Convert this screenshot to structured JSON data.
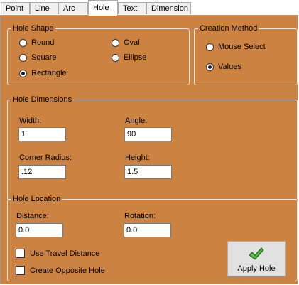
{
  "tabs": [
    {
      "label": "Point"
    },
    {
      "label": "Line"
    },
    {
      "label": "Arc"
    },
    {
      "label": "Hole",
      "active": true
    },
    {
      "label": "Text"
    },
    {
      "label": "Dimension"
    }
  ],
  "hole_shape": {
    "title": "Hole Shape",
    "options": {
      "round": "Round",
      "square": "Square",
      "rectangle": "Rectangle",
      "oval": "Oval",
      "ellipse": "Ellipse"
    },
    "selected": "Rectangle"
  },
  "creation_method": {
    "title": "Creation Method",
    "options": {
      "mouse_select": "Mouse Select",
      "values": "Values"
    },
    "selected": "Values"
  },
  "hole_dimensions": {
    "title": "Hole Dimensions",
    "width_label": "Width:",
    "width_value": "1",
    "angle_label": "Angle:",
    "angle_value": "90",
    "corner_radius_label": "Corner Radius:",
    "corner_radius_value": ".12",
    "height_label": "Height:",
    "height_value": "1.5"
  },
  "hole_location": {
    "title": "Hole Location",
    "distance_label": "Distance:",
    "distance_value": "0.0",
    "rotation_label": "Rotation:",
    "rotation_value": "0.0",
    "use_travel_distance": "Use Travel Distance",
    "create_opposite_hole": "Create Opposite Hole"
  },
  "apply_button": {
    "label": "Apply Hole",
    "icon": "green-checkmark-icon"
  },
  "colors": {
    "panel_bg": "#cc8240",
    "group_border": "#e7e7e7",
    "check_icon": "#3aa02c"
  }
}
